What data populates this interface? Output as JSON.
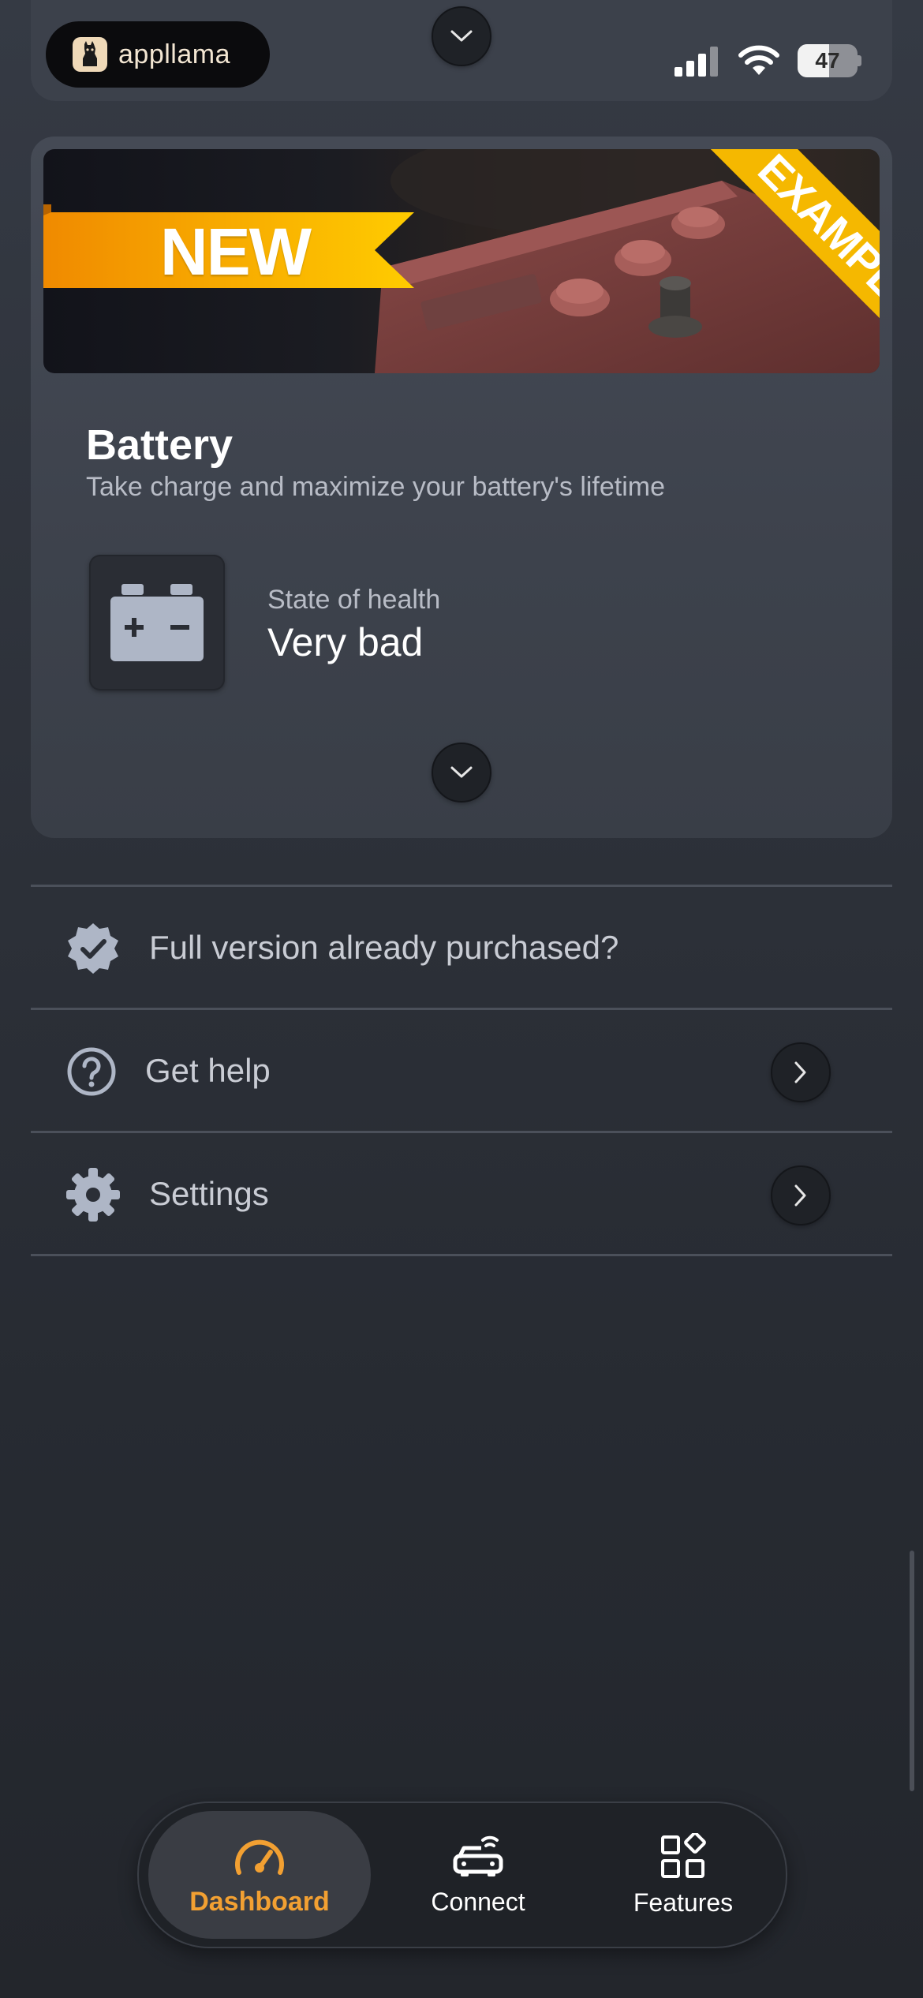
{
  "app_badge": {
    "name": "appllama"
  },
  "status_bar": {
    "battery_percent": "47"
  },
  "battery_card": {
    "banner_new_label": "NEW",
    "banner_example_label": "EXAMPLE",
    "title": "Battery",
    "subtitle": "Take charge and maximize your battery's lifetime",
    "soh_label": "State of health",
    "soh_value": "Very bad"
  },
  "menu": {
    "items": [
      {
        "label": "Full version already purchased?",
        "icon": "verified-badge-icon",
        "has_chevron": false
      },
      {
        "label": "Get help",
        "icon": "help-circle-icon",
        "has_chevron": true
      },
      {
        "label": "Settings",
        "icon": "gear-icon",
        "has_chevron": true
      }
    ]
  },
  "bottom_nav": {
    "tabs": [
      {
        "label": "Dashboard",
        "icon": "speedometer-icon",
        "active": true
      },
      {
        "label": "Connect",
        "icon": "car-wifi-icon",
        "active": false
      },
      {
        "label": "Features",
        "icon": "grid-shapes-icon",
        "active": false
      }
    ]
  },
  "colors": {
    "accent": "#f2a032",
    "banner_yellow": "#f5b800",
    "card_bg": "#424752",
    "page_bg": "#2a2e35"
  }
}
